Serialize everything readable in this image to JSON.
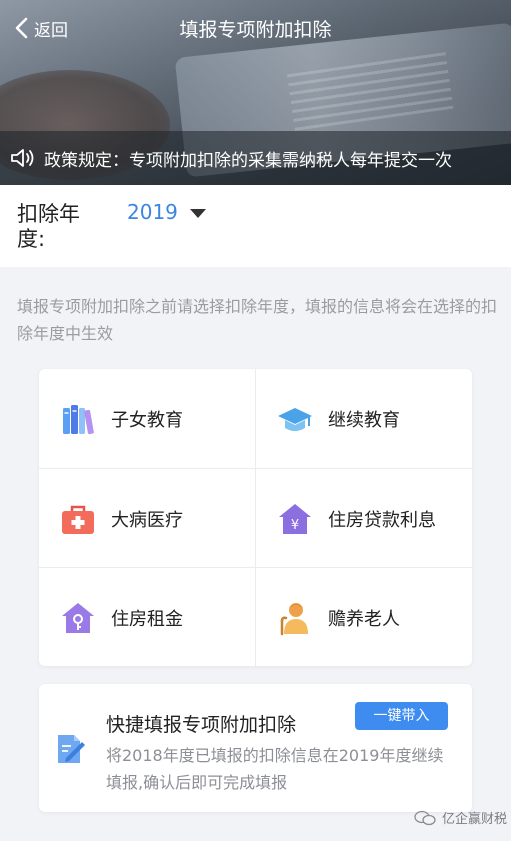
{
  "header": {
    "back_label": "返回",
    "title": "填报专项附加扣除"
  },
  "notice": {
    "text": "政策规定：专项附加扣除的采集需纳税人每年提交一次"
  },
  "year": {
    "label": "扣除年度:",
    "value": "2019"
  },
  "hint": "填报专项附加扣除之前请选择扣除年度，填报的信息将会在选择的扣除年度中生效",
  "categories": [
    {
      "label": "子女教育",
      "icon": "books-icon"
    },
    {
      "label": "继续教育",
      "icon": "graduation-cap-icon"
    },
    {
      "label": "大病医疗",
      "icon": "medical-kit-icon"
    },
    {
      "label": "住房贷款利息",
      "icon": "house-yen-icon"
    },
    {
      "label": "住房租金",
      "icon": "house-key-icon"
    },
    {
      "label": "赡养老人",
      "icon": "elderly-person-icon"
    }
  ],
  "quick_fill": {
    "title": "快捷填报专项附加扣除",
    "description": "将2018年度已填报的扣除信息在2019年度继续填报,确认后即可完成填报",
    "button_label": "一键带入",
    "icon": "edit-document-icon"
  },
  "watermark": {
    "text": "亿企赢财税",
    "icon": "wechat-icon"
  },
  "colors": {
    "accent": "#3f8cf0",
    "year_value": "#3c86e0",
    "hint_text": "#9a9ca3"
  }
}
